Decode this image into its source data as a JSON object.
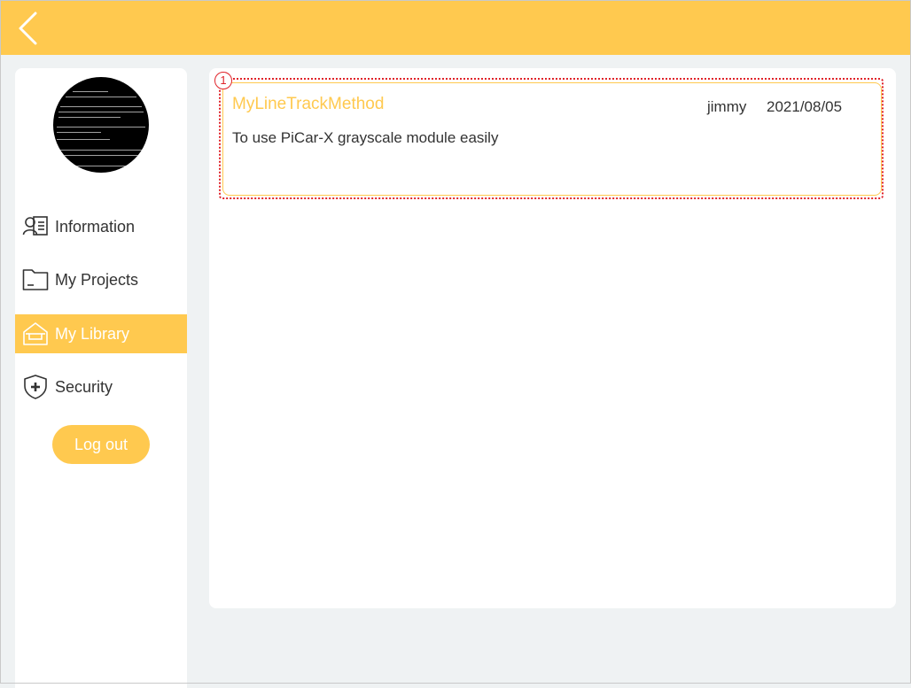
{
  "header": {
    "back_icon": "chevron-left-icon"
  },
  "sidebar": {
    "avatar": "terminal-screenshot-avatar",
    "items": [
      {
        "label": "Information",
        "icon": "user-card-icon",
        "active": false
      },
      {
        "label": "My Projects",
        "icon": "folder-icon",
        "active": false
      },
      {
        "label": "My Library",
        "icon": "home-library-icon",
        "active": true
      },
      {
        "label": "Security",
        "icon": "shield-plus-icon",
        "active": false
      }
    ],
    "logout_label": "Log out"
  },
  "library": {
    "annotation_number": "1",
    "projects": [
      {
        "title": "MyLineTrackMethod",
        "author": "jimmy",
        "date": "2021/08/05",
        "description": "To use PiCar-X grayscale module easily"
      }
    ]
  },
  "colors": {
    "accent": "#ffc94f",
    "background": "#eff2f3",
    "text": "#333333",
    "annotation": "#e0242b"
  }
}
